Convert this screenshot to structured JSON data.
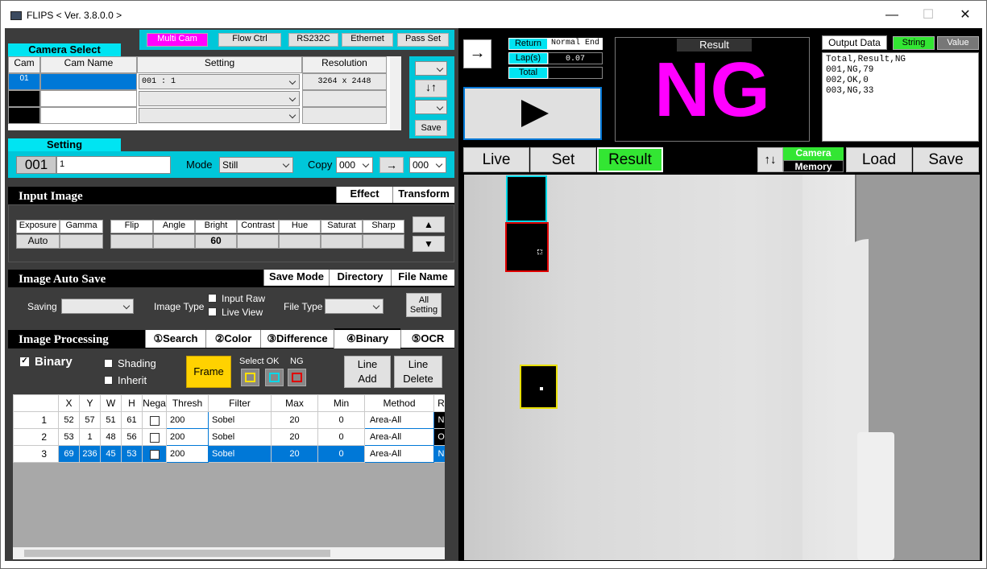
{
  "window": {
    "title": "FLIPS < Ver. 3.8.0.0 >",
    "minimize": "—",
    "maximize": "☐",
    "close": "✕"
  },
  "top_buttons": {
    "multi_cam": "Multi Cam",
    "flow_ctrl": "Flow Ctrl",
    "rs232c": "RS232C",
    "ethernet": "Ethernet",
    "pass_set": "Pass Set"
  },
  "camera_select": {
    "header": "Camera Select",
    "cols": [
      "Cam",
      "Cam Name",
      "Setting",
      "Resolution"
    ],
    "rows": [
      {
        "cam": "01",
        "name": "",
        "setting": "001 : 1",
        "res": "3264 x 2448"
      },
      {
        "cam": "",
        "name": "",
        "setting": "",
        "res": ""
      },
      {
        "cam": "",
        "name": "",
        "setting": "",
        "res": ""
      }
    ],
    "swap": "↓↑",
    "save": "Save"
  },
  "setting": {
    "header": "Setting",
    "number": "001",
    "name": "1",
    "mode_label": "Mode",
    "mode": "Still",
    "copy_label": "Copy",
    "copy_from": "000",
    "arrow": "→",
    "copy_to": "000"
  },
  "input_image": {
    "header": "Input Image",
    "tab_effect": "Effect",
    "tab_transform": "Transform",
    "labels": [
      "Exposure",
      "Gamma",
      "Flip",
      "Angle",
      "Bright",
      "Contrast",
      "Hue",
      "Saturat",
      "Sharp"
    ],
    "values": [
      "Auto",
      "",
      "",
      "",
      "60",
      "",
      "",
      "",
      ""
    ],
    "up": "▲",
    "down": "▼"
  },
  "auto_save": {
    "header": "Image Auto Save",
    "tab_mode": "Save Mode",
    "tab_dir": "Directory",
    "tab_file": "File Name",
    "saving": "Saving",
    "image_type": "Image Type",
    "input_raw": "Input Raw",
    "live_view": "Live View",
    "file_type": "File Type",
    "all1": "All",
    "all2": "Setting"
  },
  "processing": {
    "header": "Image Processing",
    "tabs": [
      "①Search",
      "②Color",
      "③Difference",
      "④Binary",
      "⑤OCR"
    ],
    "binary": "Binary",
    "shading": "Shading",
    "inherit": "Inherit",
    "frame": "Frame",
    "select_ok": "Select OK",
    "ng": "NG",
    "line_add1": "Line",
    "line_add2": "Add",
    "line_del1": "Line",
    "line_del2": "Delete",
    "cols": [
      "",
      "X",
      "Y",
      "W",
      "H",
      "Nega",
      "Thresh",
      "Filter",
      "Max",
      "Min",
      "Method",
      "R"
    ],
    "rows": [
      {
        "n": "1",
        "x": "52",
        "y": "57",
        "w": "51",
        "h": "61",
        "th": "200",
        "f": "Sobel",
        "max": "20",
        "min": "0",
        "m": "Area-All",
        "r": "N"
      },
      {
        "n": "2",
        "x": "53",
        "y": "1",
        "w": "48",
        "h": "56",
        "th": "200",
        "f": "Sobel",
        "max": "20",
        "min": "0",
        "m": "Area-All",
        "r": "O"
      },
      {
        "n": "3",
        "x": "69",
        "y": "236",
        "w": "45",
        "h": "53",
        "th": "200",
        "f": "Sobel",
        "max": "20",
        "min": "0",
        "m": "Area-All",
        "r": "N"
      }
    ]
  },
  "status": {
    "arrow": "→",
    "return": "Return",
    "return_val": "Normal End",
    "lap": "Lap(s)",
    "lap_val": "0.07",
    "total": "Total",
    "total_val": ""
  },
  "result": {
    "title": "Result",
    "value": "NG"
  },
  "output": {
    "title": "Output Data",
    "string": "String",
    "value": "Value",
    "lines": [
      "Total,Result,NG",
      "001,NG,79",
      "002,OK,0",
      "003,NG,33"
    ]
  },
  "view_tabs": {
    "live": "Live",
    "set": "Set",
    "result": "Result",
    "arrows": "↑↓",
    "camera": "Camera",
    "memory": "Memory",
    "load": "Load",
    "save": "Save"
  },
  "colors": {
    "magenta": "#ff00ff",
    "green": "#33e633",
    "cyan": "#00e4f2",
    "selected": "#0078d7"
  }
}
